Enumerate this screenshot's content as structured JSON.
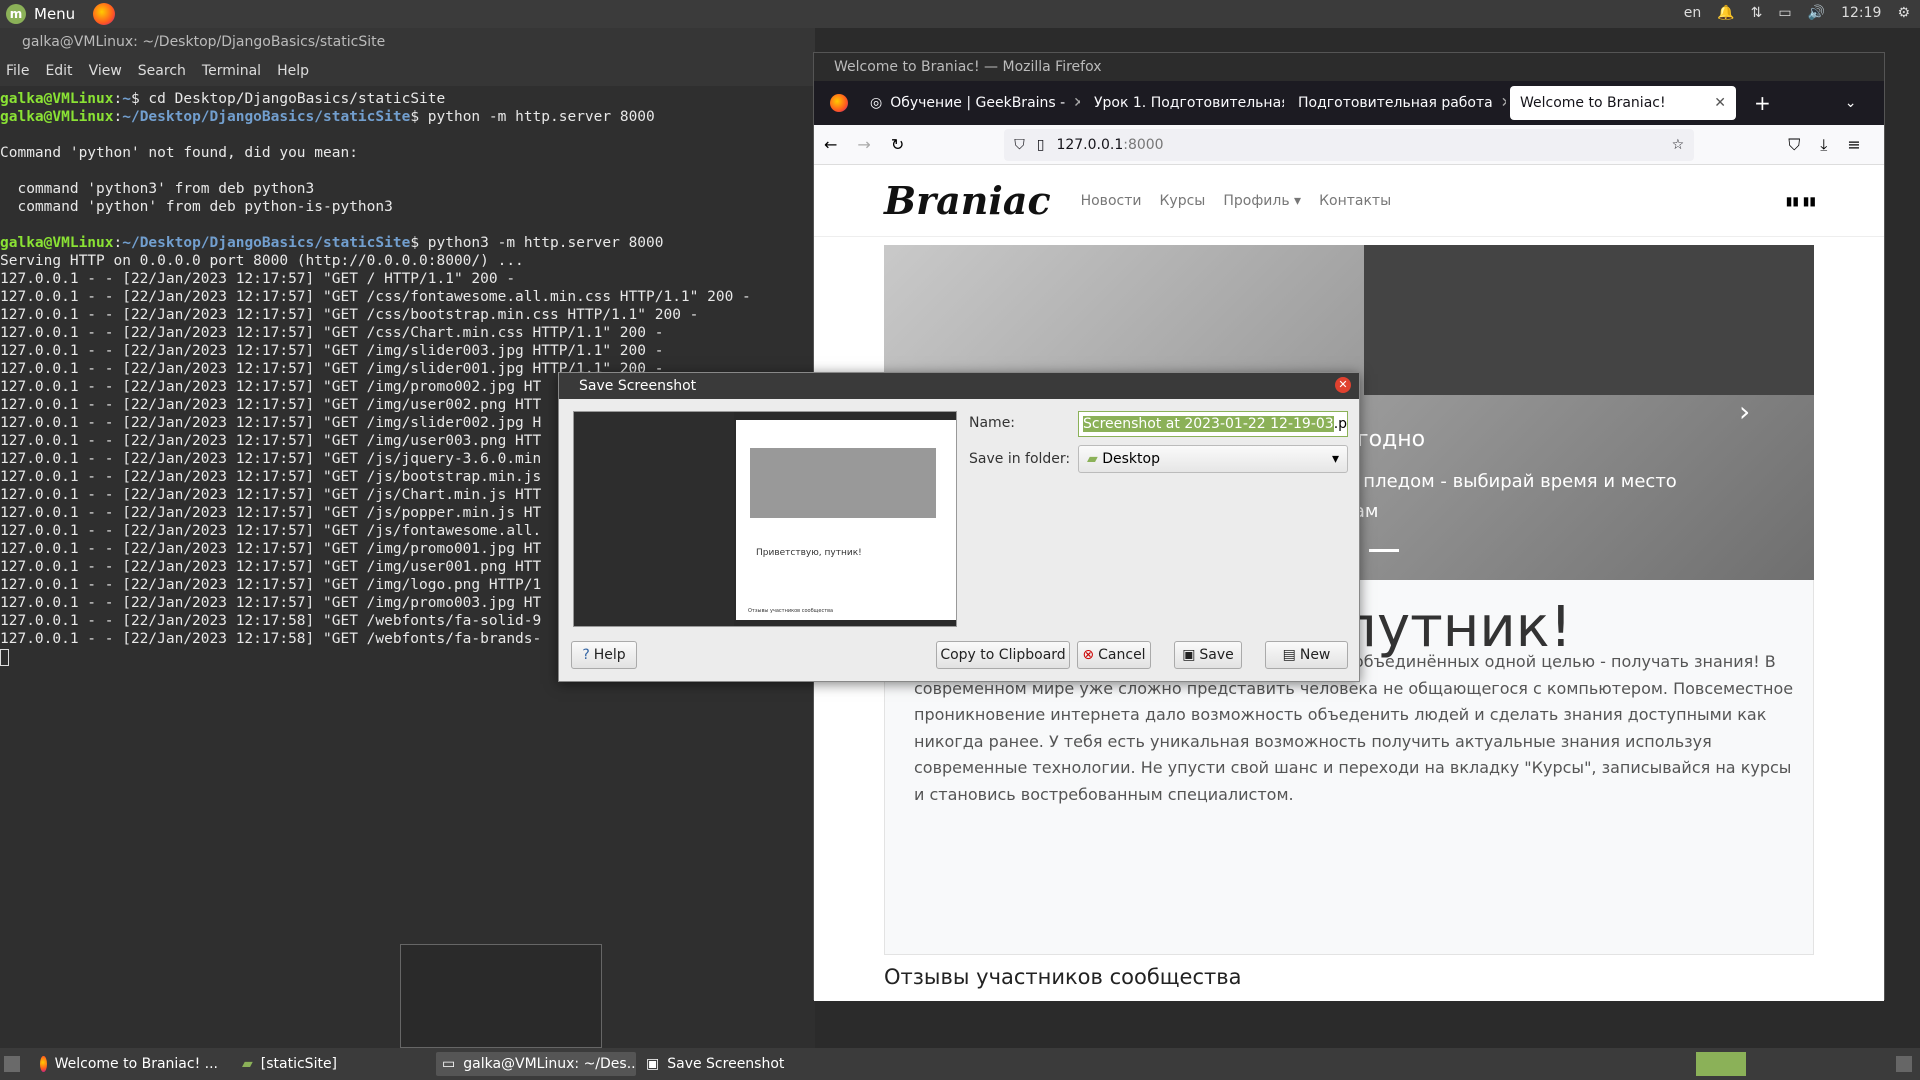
{
  "top_panel": {
    "menu_label": "Menu",
    "lang": "en",
    "time": "12:19"
  },
  "terminal": {
    "title": "galka@VMLinux: ~/Desktop/DjangoBasics/staticSite",
    "menu": [
      "File",
      "Edit",
      "View",
      "Search",
      "Terminal",
      "Help"
    ],
    "lines": [
      {
        "user": "galka@VMLinux",
        "path": "~",
        "cmd": "$ cd Desktop/DjangoBasics/staticSite"
      },
      {
        "user": "galka@VMLinux",
        "path": "~/Desktop/DjangoBasics/staticSite",
        "cmd": "$ python -m http.server 8000"
      },
      {
        "text": ""
      },
      {
        "text": "Command 'python' not found, did you mean:"
      },
      {
        "text": ""
      },
      {
        "text": "  command 'python3' from deb python3"
      },
      {
        "text": "  command 'python' from deb python-is-python3"
      },
      {
        "text": ""
      },
      {
        "user": "galka@VMLinux",
        "path": "~/Desktop/DjangoBasics/staticSite",
        "cmd": "$ python3 -m http.server 8000"
      },
      {
        "text": "Serving HTTP on 0.0.0.0 port 8000 (http://0.0.0.0:8000/) ..."
      },
      {
        "text": "127.0.0.1 - - [22/Jan/2023 12:17:57] \"GET / HTTP/1.1\" 200 -"
      },
      {
        "text": "127.0.0.1 - - [22/Jan/2023 12:17:57] \"GET /css/fontawesome.all.min.css HTTP/1.1\" 200 -"
      },
      {
        "text": "127.0.0.1 - - [22/Jan/2023 12:17:57] \"GET /css/bootstrap.min.css HTTP/1.1\" 200 -"
      },
      {
        "text": "127.0.0.1 - - [22/Jan/2023 12:17:57] \"GET /css/Chart.min.css HTTP/1.1\" 200 -"
      },
      {
        "text": "127.0.0.1 - - [22/Jan/2023 12:17:57] \"GET /img/slider003.jpg HTTP/1.1\" 200 -"
      },
      {
        "text": "127.0.0.1 - - [22/Jan/2023 12:17:57] \"GET /img/slider001.jpg HTTP/1.1\" 200 -"
      },
      {
        "text": "127.0.0.1 - - [22/Jan/2023 12:17:57] \"GET /img/promo002.jpg HT"
      },
      {
        "text": "127.0.0.1 - - [22/Jan/2023 12:17:57] \"GET /img/user002.png HTT"
      },
      {
        "text": "127.0.0.1 - - [22/Jan/2023 12:17:57] \"GET /img/slider002.jpg H"
      },
      {
        "text": "127.0.0.1 - - [22/Jan/2023 12:17:57] \"GET /img/user003.png HTT"
      },
      {
        "text": "127.0.0.1 - - [22/Jan/2023 12:17:57] \"GET /js/jquery-3.6.0.min"
      },
      {
        "text": "127.0.0.1 - - [22/Jan/2023 12:17:57] \"GET /js/bootstrap.min.js"
      },
      {
        "text": "127.0.0.1 - - [22/Jan/2023 12:17:57] \"GET /js/Chart.min.js HTT"
      },
      {
        "text": "127.0.0.1 - - [22/Jan/2023 12:17:57] \"GET /js/popper.min.js HT"
      },
      {
        "text": "127.0.0.1 - - [22/Jan/2023 12:17:57] \"GET /js/fontawesome.all."
      },
      {
        "text": "127.0.0.1 - - [22/Jan/2023 12:17:57] \"GET /img/promo001.jpg HT"
      },
      {
        "text": "127.0.0.1 - - [22/Jan/2023 12:17:57] \"GET /img/user001.png HTT"
      },
      {
        "text": "127.0.0.1 - - [22/Jan/2023 12:17:57] \"GET /img/logo.png HTTP/1"
      },
      {
        "text": "127.0.0.1 - - [22/Jan/2023 12:17:57] \"GET /img/promo003.jpg HT"
      },
      {
        "text": "127.0.0.1 - - [22/Jan/2023 12:17:58] \"GET /webfonts/fa-solid-9"
      },
      {
        "text": "127.0.0.1 - - [22/Jan/2023 12:17:58] \"GET /webfonts/fa-brands-"
      }
    ]
  },
  "firefox": {
    "title": "Welcome to Braniac! — Mozilla Firefox",
    "tabs": [
      {
        "label": "Обучение | GeekBrains -"
      },
      {
        "label": "Урок 1. Подготовительная"
      },
      {
        "label": "Подготовительная работа"
      },
      {
        "label": "Welcome to Braniac!"
      }
    ],
    "url_host": "127.0.0.1",
    "url_port": ":8000",
    "page": {
      "logo": "Braniac",
      "nav": [
        "Новости",
        "Курсы",
        "Профиль",
        "Контакты"
      ],
      "carousel_heading": "угодно",
      "carousel_line1": "м пледом - выбирай время и место",
      "carousel_line2": "сам",
      "hero_title": "Приветствую, путник!",
      "body": "На данном портале мы собрали сообщество людей объединённых одной целью - получать знания! В современном мире уже сложно представить человека не общающегося с компьютером. Повсеместное проникновение интернета дало возможность объеденить людей и сделать знания доступными как никогда ранее. У тебя есть уникальная возможность получить актуальные знания используя современные технологии. Не упусти свой шанс и переходи на вкладку \"Курсы\", записывайся на курсы и становись востребованным специалистом.",
      "reviews_heading": "Отзывы участников сообщества"
    }
  },
  "dialog": {
    "title": "Save Screenshot",
    "name_label": "Name:",
    "name_selected": "Screenshot at 2023-01-22 12-19-03",
    "name_ext": ".png",
    "folder_label": "Save in folder:",
    "folder_value": "Desktop",
    "help": "Help",
    "copy": "Copy to Clipboard",
    "cancel": "Cancel",
    "save": "Save",
    "new": "New",
    "thumb_text": "Приветствую, путник!",
    "thumb_caption": "Отзывы участников сообщества"
  },
  "taskbar": [
    {
      "label": "Welcome to Braniac! ..."
    },
    {
      "label": "[staticSite]"
    },
    {
      "label": "galka@VMLinux: ~/Des..."
    },
    {
      "label": "Save Screenshot"
    }
  ]
}
